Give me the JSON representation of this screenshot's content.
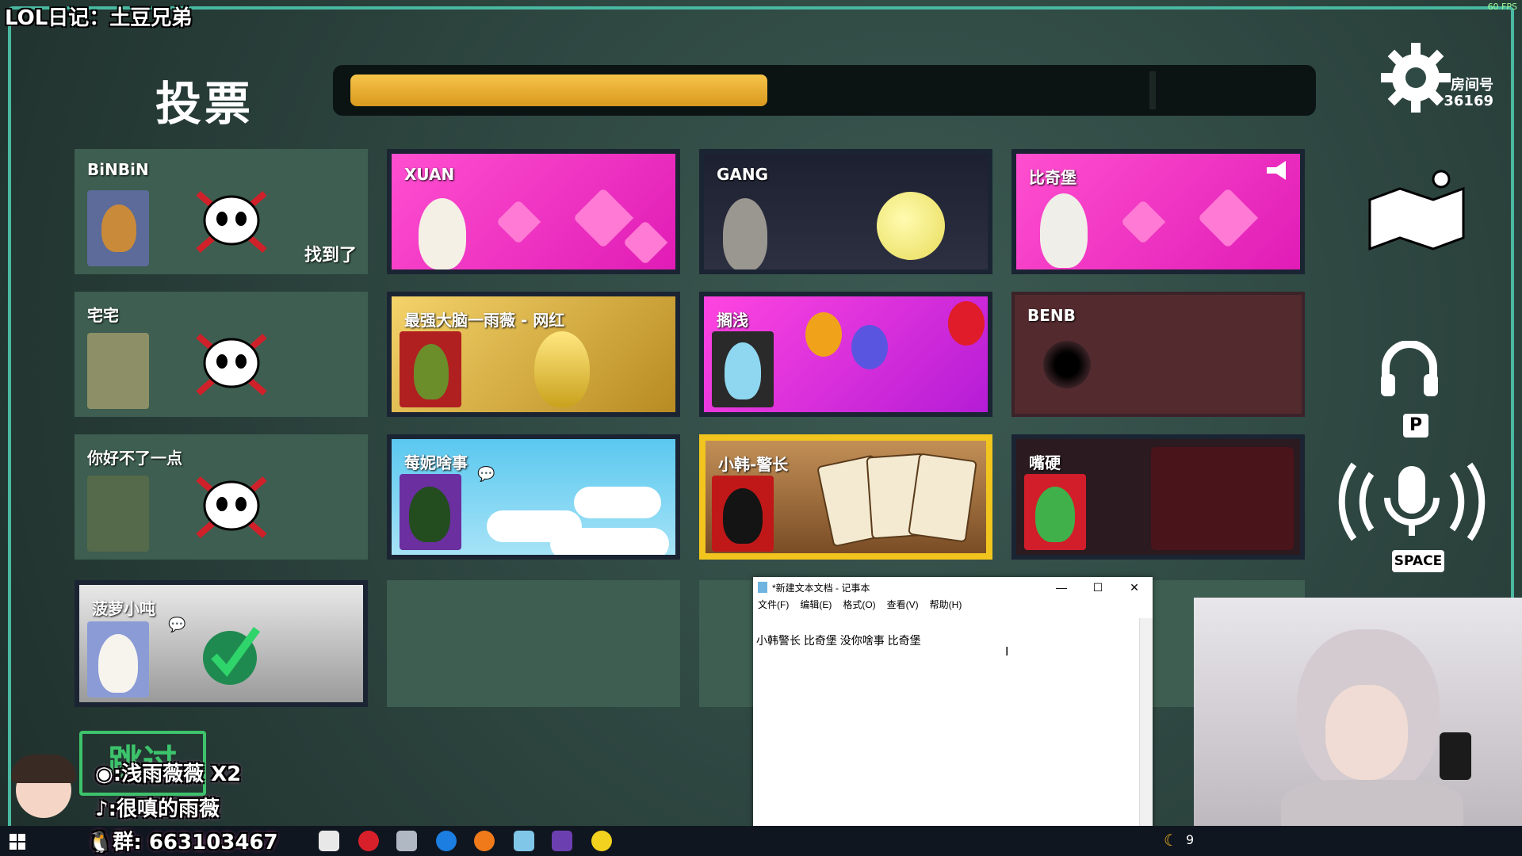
{
  "overlay": {
    "title": "LOL日记：土豆兄弟",
    "fps": "60 FPS"
  },
  "vote": {
    "title": "投票",
    "progress": 0.44
  },
  "players": [
    {
      "name": "BiNBiN",
      "status": "dead",
      "found_label": "找到了"
    },
    {
      "name": "XUAN",
      "status": "alive"
    },
    {
      "name": "GANG",
      "status": "alive"
    },
    {
      "name": "比奇堡",
      "status": "alive"
    },
    {
      "name": "宅宅",
      "status": "dead"
    },
    {
      "name": "最强大脑一雨薇 - 网红",
      "status": "alive"
    },
    {
      "name": "搁浅",
      "status": "alive"
    },
    {
      "name": "BENB",
      "status": "dead"
    },
    {
      "name": "你好不了一点",
      "status": "dead"
    },
    {
      "name": "莓妮啥事",
      "status": "alive"
    },
    {
      "name": "小韩-警长",
      "status": "alive",
      "selected": true
    },
    {
      "name": "嘴硬",
      "status": "alive"
    },
    {
      "name": "菠萝小吨",
      "status": "voted"
    }
  ],
  "sidebar": {
    "room_label": "房间号",
    "room_number": "36169",
    "push_to_talk_key": "P",
    "voice_key": "SPACE"
  },
  "skip": {
    "label": "跳过"
  },
  "social": {
    "weibo": ":浅雨薇薇 X2",
    "douyin": ":很嗔的雨薇",
    "qq_group": "群: 663103467"
  },
  "notepad": {
    "title": "*新建文本文档 - 记事本",
    "menu": [
      "文件(F)",
      "编辑(E)",
      "格式(O)",
      "查看(V)",
      "帮助(H)"
    ],
    "content": "小韩警长  比奇堡 没你啥事 比奇堡",
    "minimize": "—",
    "maximize": "☐",
    "close": "✕"
  },
  "taskbar": {
    "clock_partial": "9"
  },
  "colors": {
    "accent": "#49b9a1",
    "timer": "#f6c44a",
    "selected": "#f2c51e"
  }
}
